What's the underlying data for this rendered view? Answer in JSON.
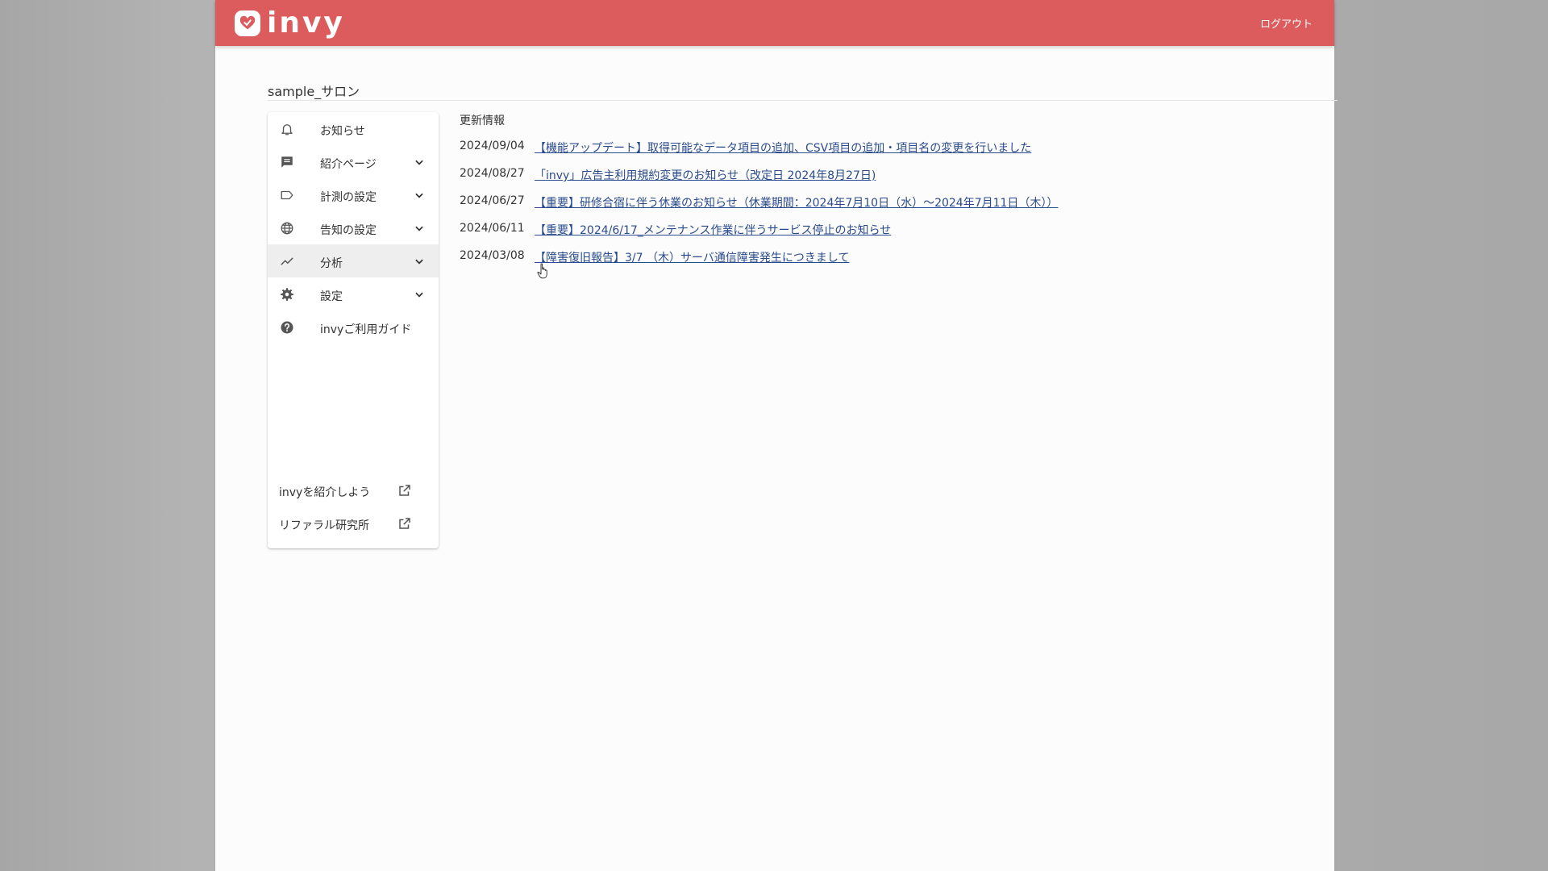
{
  "app": {
    "brand": "invy",
    "logout_label": "ログアウト",
    "accent_color": "#dc5b5d",
    "link_color": "#2a4b8d"
  },
  "page": {
    "salon_name": "sample_サロン"
  },
  "sidebar": {
    "items": [
      {
        "label": "お知らせ",
        "icon": "bell-icon",
        "has_chevron": false
      },
      {
        "label": "紹介ページ",
        "icon": "message-icon",
        "has_chevron": true
      },
      {
        "label": "計測の設定",
        "icon": "tag-icon",
        "has_chevron": true
      },
      {
        "label": "告知の設定",
        "icon": "globe-icon",
        "has_chevron": true
      },
      {
        "label": "分析",
        "icon": "trend-icon",
        "has_chevron": true,
        "active": true
      },
      {
        "label": "設定",
        "icon": "gear-icon",
        "has_chevron": true
      },
      {
        "label": "invyご利用ガイド",
        "icon": "help-icon",
        "has_chevron": false
      }
    ],
    "external_links": [
      {
        "label": "invyを紹介しよう",
        "icon": "external-link-icon"
      },
      {
        "label": "リファラル研究所",
        "icon": "external-link-icon"
      }
    ]
  },
  "news": {
    "heading": "更新情報",
    "items": [
      {
        "date": "2024/09/04",
        "title": "【機能アップデート】取得可能なデータ項目の追加、CSV項目の追加・項目名の変更を行いました"
      },
      {
        "date": "2024/08/27",
        "title": "「invy」広告主利用規約変更のお知らせ（改定日 2024年8月27日)"
      },
      {
        "date": "2024/06/27",
        "title": "【重要】研修合宿に伴う休業のお知らせ（休業期間：2024年7月10日（水）〜2024年7月11日（木））"
      },
      {
        "date": "2024/06/11",
        "title": "【重要】2024/6/17_メンテナンス作業に伴うサービス停止のお知らせ"
      },
      {
        "date": "2024/03/08",
        "title": "【障害復旧報告】3/7 （木）サーバ通信障害発生につきまして"
      }
    ]
  }
}
